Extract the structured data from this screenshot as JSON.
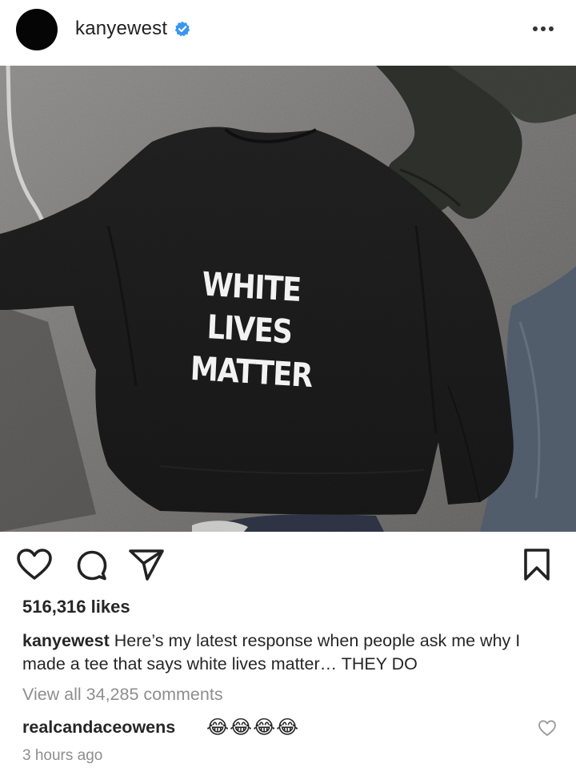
{
  "post": {
    "username": "kanyewest",
    "verified": true,
    "more_icon": "more-horizontal-icon",
    "photo": {
      "shirt_text": [
        "WHITE",
        "LIVES",
        "MATTER"
      ]
    },
    "likes": "516,316 likes",
    "caption": {
      "username": "kanyewest",
      "text": "Here’s my latest response when people ask me why I made a tee that says white lives matter… THEY DO"
    },
    "view_all_comments": "View all 34,285 comments",
    "top_comment": {
      "username": "realcandaceowens",
      "text": "😂😂😂😂"
    },
    "timestamp": "3 hours ago"
  },
  "colors": {
    "verified_blue": "#3897f0",
    "text_primary": "#262626",
    "text_secondary": "#8e8e8e"
  }
}
